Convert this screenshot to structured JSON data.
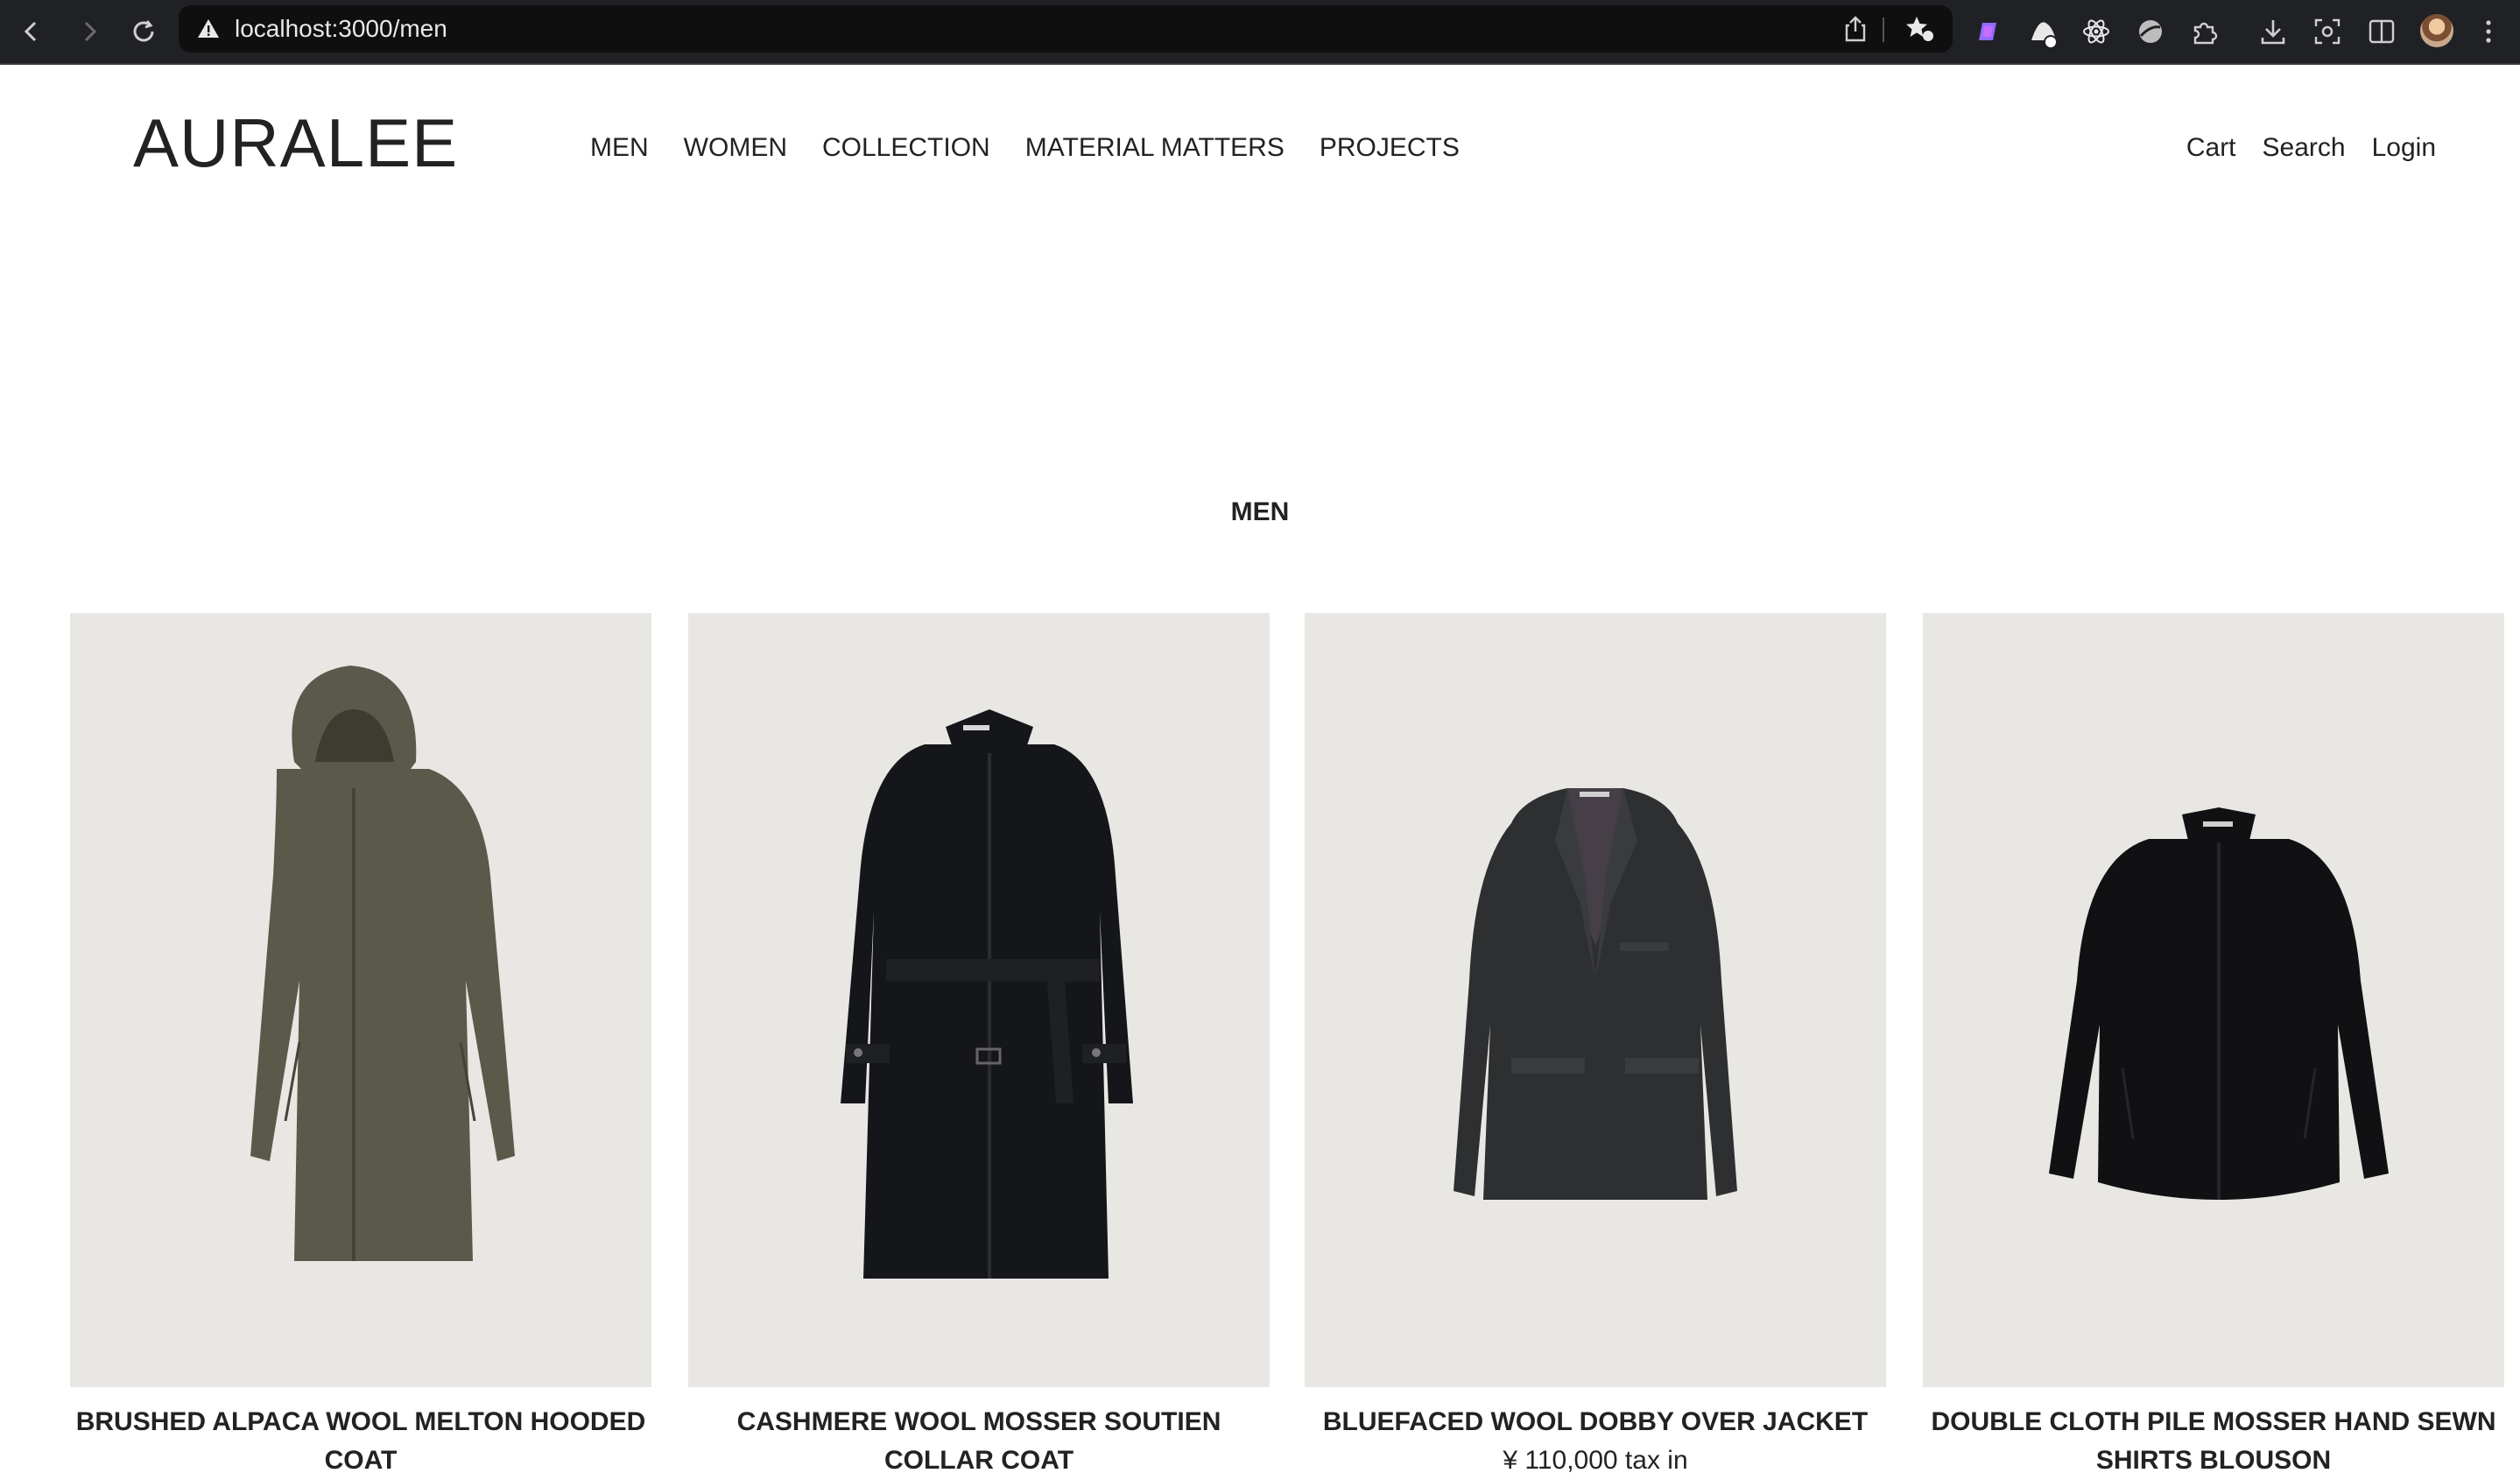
{
  "browser": {
    "url": "localhost:3000/men",
    "extensions": [
      "puzzle-pink-icon",
      "cone-icon",
      "atom-icon",
      "ball-icon",
      "puzzle-icon"
    ],
    "tools": [
      "download-icon",
      "screenshot-icon",
      "sidebar-icon"
    ]
  },
  "site": {
    "logo": "AURALEE",
    "nav": [
      "MEN",
      "WOMEN",
      "COLLECTION",
      "MATERIAL MATTERS",
      "PROJECTS"
    ],
    "util": [
      "Cart",
      "Search",
      "Login"
    ]
  },
  "page": {
    "title": "MEN"
  },
  "products": [
    {
      "name": "BRUSHED ALPACA WOOL MELTON HOODED COAT",
      "price": "",
      "color": "#5b5a4a"
    },
    {
      "name": "CASHMERE WOOL MOSSER SOUTIEN COLLAR COAT",
      "price": "",
      "color": "#15161a"
    },
    {
      "name": "BLUEFACED WOOL DOBBY OVER JACKET",
      "price": "¥ 110,000 tax in",
      "color": "#2e2f31"
    },
    {
      "name": "DOUBLE CLOTH PILE MOSSER HAND SEWN SHIRTS BLOUSON",
      "price": "",
      "color": "#111113"
    }
  ]
}
